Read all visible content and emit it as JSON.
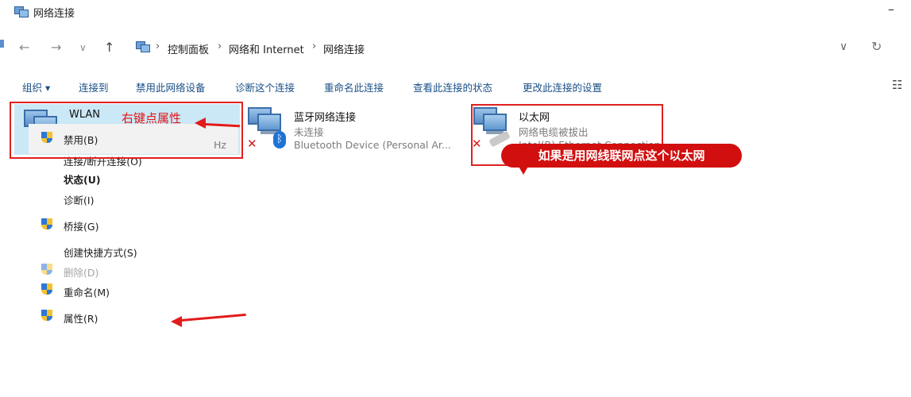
{
  "window": {
    "title": "网络连接",
    "minimize_glyph": "–"
  },
  "nav": {
    "back_glyph": "←",
    "forward_glyph": "→",
    "recent_glyph": "∨",
    "up_glyph": "↑",
    "crumbs": [
      "控制面板",
      "网络和 Internet",
      "网络连接"
    ],
    "crumb_sep": "›",
    "history_glyph": "∨",
    "refresh_glyph": "↻"
  },
  "commandbar": {
    "items": [
      "组织 ▾",
      "连接到",
      "禁用此网络设备",
      "诊断这个连接",
      "重命名此连接",
      "查看此连接的状态",
      "更改此连接的设置"
    ],
    "view_glyph": "☷"
  },
  "connections": {
    "wlan": {
      "name": "WLAN",
      "detail_tail": "Hz"
    },
    "bluetooth": {
      "name": "蓝牙网络连接",
      "status": "未连接",
      "device": "Bluetooth Device (Personal Ar...",
      "badge_glyph": "ᛒ"
    },
    "ethernet": {
      "name": "以太网",
      "status": "网络电缆被拔出",
      "device": "Intel(R) Ethernet Connection"
    },
    "x_glyph": "✕"
  },
  "context_menu": {
    "items": [
      {
        "label": "禁用(B)",
        "shield": true,
        "state": "normal"
      },
      {
        "label": "连接/断开连接(O)",
        "shield": false,
        "state": "normal"
      },
      {
        "label": "状态(U)",
        "shield": false,
        "state": "bold"
      },
      {
        "label": "诊断(I)",
        "shield": false,
        "state": "normal"
      },
      {
        "label": "桥接(G)",
        "shield": true,
        "state": "normal"
      },
      {
        "label": "创建快捷方式(S)",
        "shield": false,
        "state": "normal"
      },
      {
        "label": "删除(D)",
        "shield": true,
        "state": "disabled"
      },
      {
        "label": "重命名(M)",
        "shield": true,
        "state": "normal"
      },
      {
        "label": "属性(R)",
        "shield": true,
        "state": "normal"
      }
    ]
  },
  "annotations": {
    "right_click_hint": "右键点属性",
    "ethernet_hint": "如果是用网线联网点这个以太网",
    "color": "#e02020"
  },
  "icons": [
    "network-connections-icon",
    "shield-icon",
    "bluetooth-icon",
    "red-x-icon",
    "network-cable-icon",
    "view-options-icon"
  ]
}
